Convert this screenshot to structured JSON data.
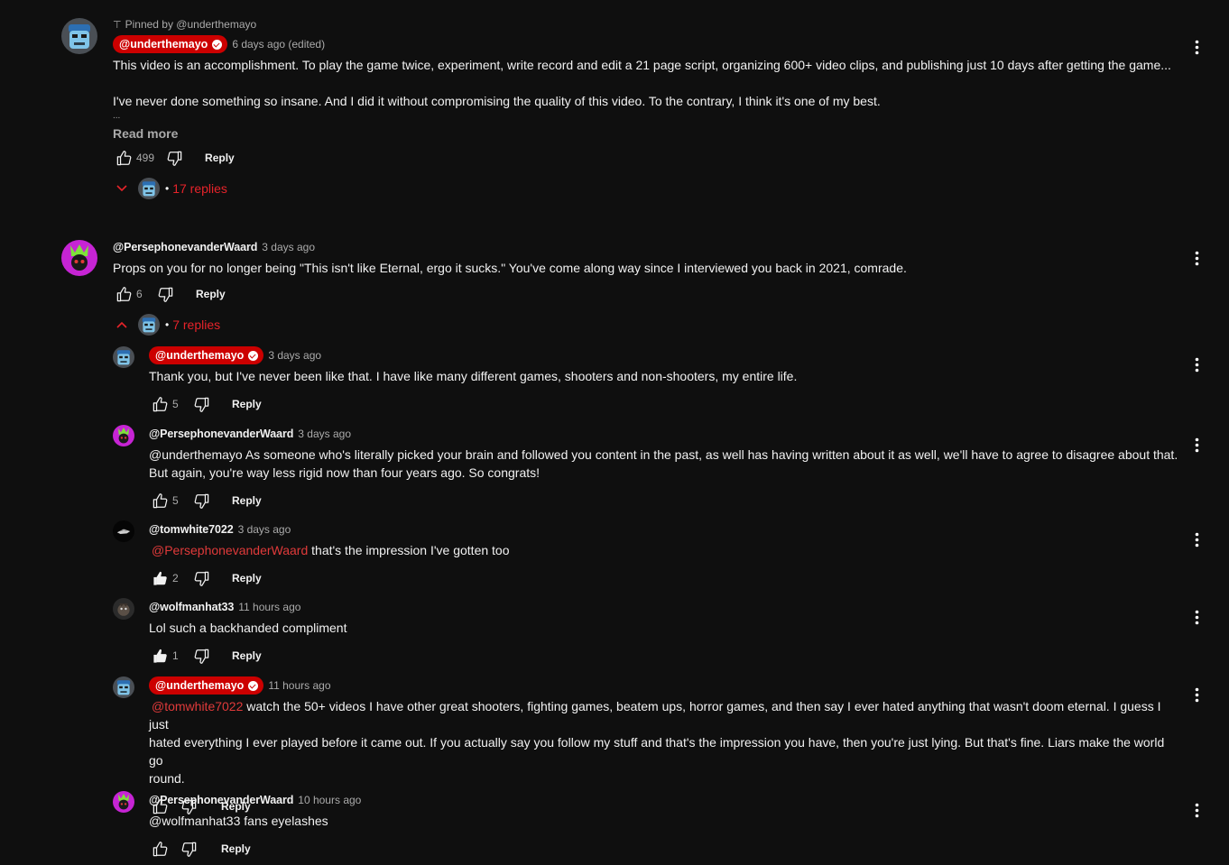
{
  "icons": {
    "like": "thumb-up-icon",
    "dislike": "thumb-down-icon",
    "more": "more-vert-icon",
    "pin": "pin-icon",
    "verified": "verified-check-icon"
  },
  "colors": {
    "background": "#0f0f0f",
    "creator_badge": "#cc0000",
    "mention": "#e03a3a",
    "replies_link": "#e6232a"
  },
  "comments": [
    {
      "pinned_label": "Pinned by @underthemayo",
      "author": "@underthemayo",
      "time": "6 days ago (edited)",
      "text_line1": "This video is an accomplishment. To play the game twice, experiment, write record and edit a 21 page script, organizing 600+ video clips, and publishing just 10 days after getting the game...",
      "text_line2": "I've never done something so insane. And I did it without compromising the quality of this video. To the contrary, I think it's one of my best.",
      "text_line3": "...",
      "read_more": "Read more",
      "likes": "499",
      "reply_label": "Reply",
      "replies_label": "17 replies"
    },
    {
      "author": "@PersephonevanderWaard",
      "time": "3 days ago",
      "text": "Props on you for no longer being \"This isn't like Eternal, ergo it sucks.\" You've come along way since I interviewed you back in 2021, comrade.",
      "likes": "6",
      "reply_label": "Reply",
      "replies_label": "7 replies"
    }
  ],
  "replies": [
    {
      "author": "@underthemayo",
      "time": "3 days ago",
      "text": "Thank you, but I've never been like that. I have like many different games, shooters and non-shooters, my entire life.",
      "likes": "5",
      "reply_label": "Reply"
    },
    {
      "author": "@PersephonevanderWaard",
      "time": "3 days ago",
      "text_line1": "@underthemayo As someone who's literally picked your brain and followed you content in the past, as well has having written about it as well, we'll have to agree to disagree about that.",
      "text_line2": "But again, you're way less rigid now than four years ago. So congrats!",
      "likes": "5",
      "reply_label": "Reply"
    },
    {
      "author": "@tomwhite7022",
      "time": "3 days ago",
      "mention": "@PersephonevanderWaard",
      "text": "that's the impression I've gotten too",
      "likes": "2",
      "reply_label": "Reply"
    },
    {
      "author": "@wolfmanhat33",
      "time": "11 hours ago",
      "text": "Lol such a backhanded compliment",
      "likes": "1",
      "reply_label": "Reply"
    },
    {
      "author": "@underthemayo",
      "time": "11 hours ago",
      "mention": "@tomwhite7022",
      "text_line1": "watch the 50+ videos I have other great shooters, fighting games, beatem ups, horror games, and then say I ever hated anything that wasn't doom eternal. I guess I just",
      "text_line2": "hated everything I ever played before it came out. If you actually say you follow my stuff and that's the impression you have, then you're just lying. But that's fine. Liars make the world go",
      "text_line3": "round.",
      "reply_label": "Reply"
    },
    {
      "author": "@PersephonevanderWaard",
      "time": "10 hours ago",
      "text": "@wolfmanhat33  fans eyelashes",
      "reply_label": "Reply"
    }
  ]
}
